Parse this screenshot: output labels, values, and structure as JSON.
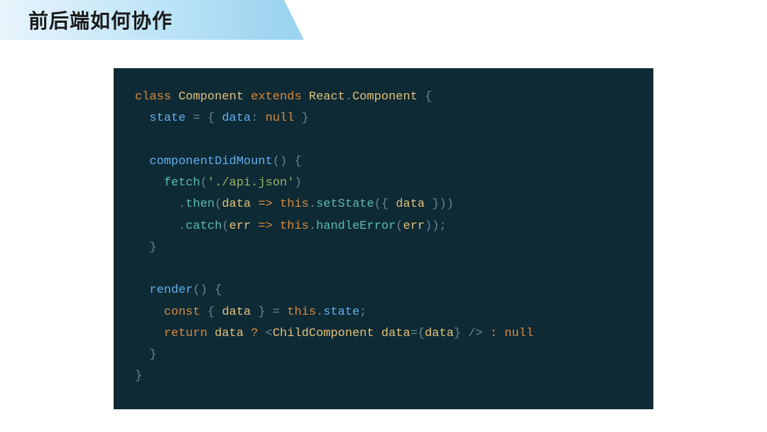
{
  "slide": {
    "title": "前后端如何协作"
  },
  "code": {
    "line1_class": "class",
    "line1_component": "Component",
    "line1_extends": "extends",
    "line1_react": "React",
    "line1_reactcomp": "Component",
    "line2_state": "state",
    "line2_data": "data",
    "line2_null": "null",
    "line4_cdm": "componentDidMount",
    "line5_fetch": "fetch",
    "line5_apijson": "'./api.json'",
    "line6_then": "then",
    "line6_data1": "data",
    "line6_arrow": "=>",
    "line6_this": "this",
    "line6_setstate": "setState",
    "line6_data2": "data",
    "line7_catch": "catch",
    "line7_err": "err",
    "line7_arrow": "=>",
    "line7_this": "this",
    "line7_handle": "handleError",
    "line7_err2": "err",
    "line10_render": "render",
    "line11_const": "const",
    "line11_data": "data",
    "line11_this": "this",
    "line11_state": "state",
    "line12_return": "return",
    "line12_data": "data",
    "line12_child": "ChildComponent",
    "line12_dataAttr": "data",
    "line12_dataVal": "data",
    "line12_null": "null"
  }
}
